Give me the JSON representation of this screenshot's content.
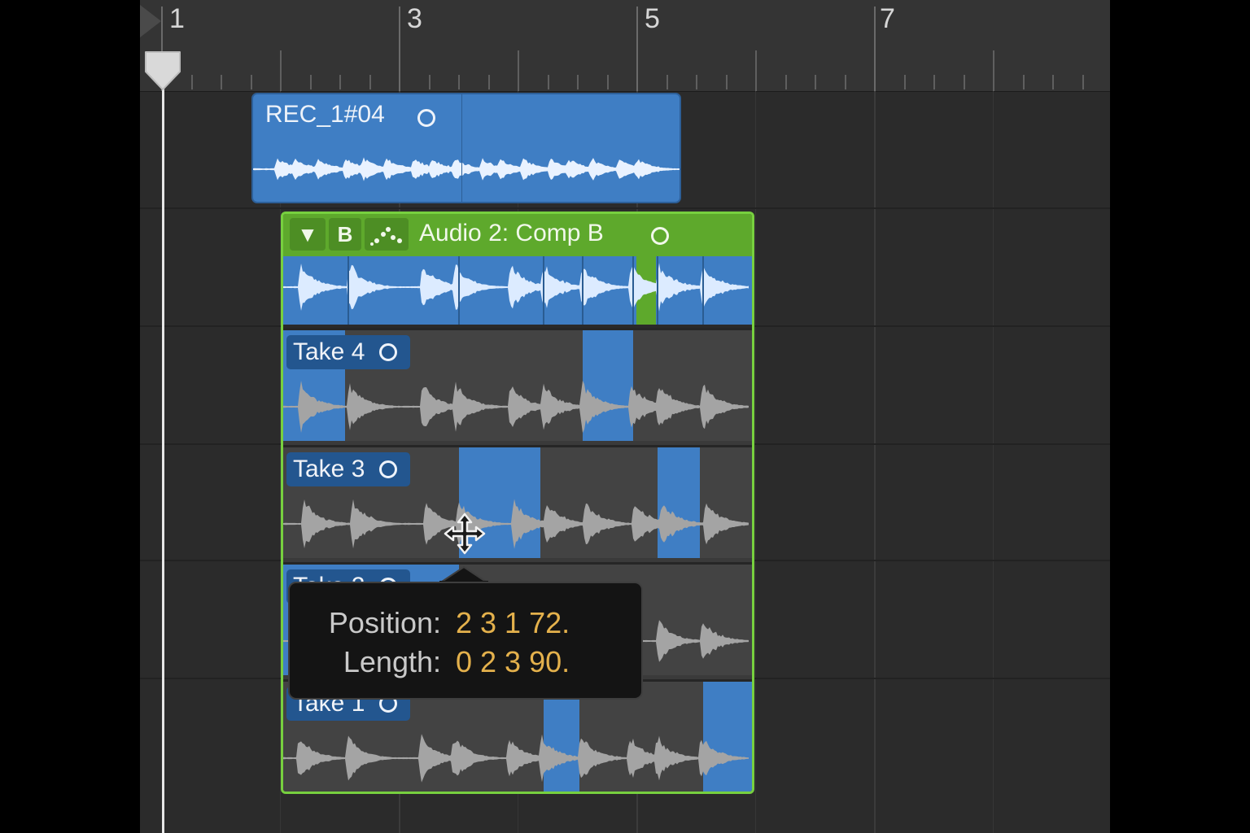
{
  "ruler": {
    "bars": [
      "1",
      "3",
      "5",
      "7"
    ]
  },
  "region": {
    "name": "REC_1#04"
  },
  "folder": {
    "toggle": "▼",
    "comp_letter": "B",
    "title": "Audio 2: Comp B"
  },
  "takes": [
    {
      "label": "Take 4"
    },
    {
      "label": "Take 3"
    },
    {
      "label": "Take 2"
    },
    {
      "label": "Take 1"
    }
  ],
  "tooltip": {
    "position_label": "Position:",
    "position_value": "2 3 1 72.",
    "length_label": "Length:",
    "length_value": "0 2 3 90."
  },
  "colors": {
    "region_blue": "#3f7ec4",
    "folder_green": "#5ea92c",
    "tooltip_value": "#e4b14c"
  }
}
